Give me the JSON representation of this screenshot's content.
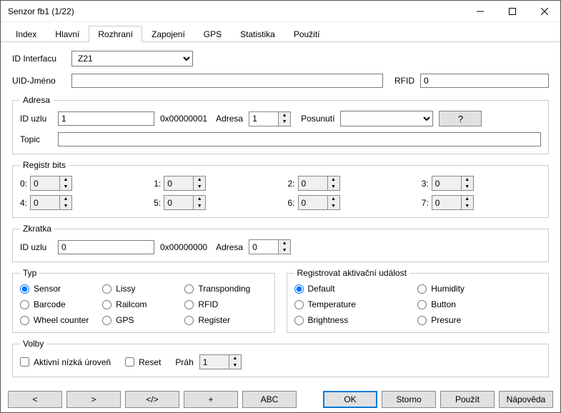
{
  "title": "Senzor fb1 (1/22)",
  "tabs": [
    "Index",
    "Hlavní",
    "Rozhraní",
    "Zapojení",
    "GPS",
    "Statistika",
    "Použití"
  ],
  "active_tab": "Rozhraní",
  "labels": {
    "id_interface": "ID Interfacu",
    "uid_name": "UID-Jméno",
    "rfid": "RFID",
    "adresa_group": "Adresa",
    "id_uzlu": "ID uzlu",
    "hex1": "0x00000001",
    "adresa": "Adresa",
    "posunuti": "Posunutí",
    "qmark": "?",
    "topic": "Topic",
    "regbits": "Registr bits",
    "rb": [
      "0:",
      "1:",
      "2:",
      "3:",
      "4:",
      "5:",
      "6:",
      "7:"
    ],
    "zkratka": "Zkratka",
    "hex0": "0x00000000",
    "typ": "Typ",
    "typ_opts": [
      "Sensor",
      "Lissy",
      "Transponding",
      "Barcode",
      "Railcom",
      "RFID",
      "Wheel counter",
      "GPS",
      "Register"
    ],
    "reg_event": "Registrovat aktivační událost",
    "reg_opts": [
      "Default",
      "Humidity",
      "Temperature",
      "Button",
      "Brightness",
      "Presure"
    ],
    "volby": "Volby",
    "active_low": "Aktivní nízká úroveň",
    "reset": "Reset",
    "prah": "Práh"
  },
  "values": {
    "interface": "Z21",
    "uid_name": "",
    "rfid": "0",
    "adresa_id_uzlu": "1",
    "adresa_adresa": "1",
    "adresa_posunuti": "",
    "topic": "",
    "rb": [
      "0",
      "0",
      "0",
      "0",
      "0",
      "0",
      "0",
      "0"
    ],
    "zkr_id_uzlu": "0",
    "zkr_adresa": "0",
    "typ_selected": "Sensor",
    "reg_selected": "Default",
    "active_low": false,
    "reset": false,
    "prah": "1"
  },
  "footer": {
    "prev": "<",
    "next": ">",
    "code": "</>",
    "plus": "+",
    "abc": "ABC",
    "ok": "OK",
    "storno": "Storno",
    "pouzit": "Použít",
    "napoveda": "Nápověda"
  }
}
